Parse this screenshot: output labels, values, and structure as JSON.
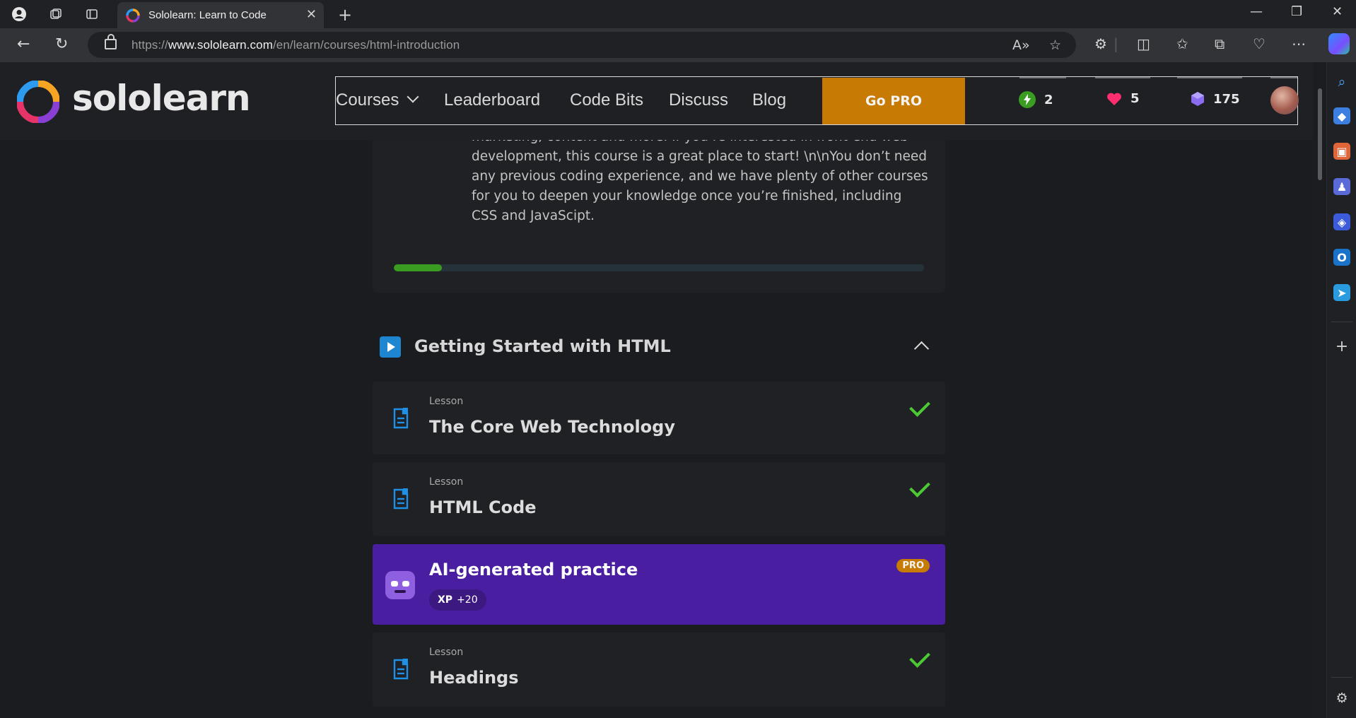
{
  "browser": {
    "tab_title": "Sololearn: Learn to Code",
    "url_prefix": "https://",
    "url_host": "www.sololearn.com",
    "url_path": "/en/learn/courses/html-introduction"
  },
  "header": {
    "logo_text": "sololearn",
    "nav": {
      "courses": "Courses",
      "leaderboard": "Leaderboard",
      "code_bits": "Code Bits",
      "discuss": "Discuss",
      "blog": "Blog"
    },
    "go_pro": "Go PRO",
    "stats": {
      "streak": "2",
      "hearts": "5",
      "gems": "175"
    }
  },
  "course": {
    "description": "marketing, content and more. If you’re interested in front-end web development, this course is a great place to start! \\n\\nYou don’t need any previous coding experience, and we have plenty of other courses for you to deepen your knowledge once you’re finished, including CSS and JavaScipt.",
    "progress": 0.09
  },
  "module": {
    "title": "Getting Started with HTML",
    "lessons": [
      {
        "type": "Lesson",
        "title": "The Core Web Technology",
        "completed": true
      },
      {
        "type": "Lesson",
        "title": "HTML Code",
        "completed": true
      },
      {
        "type": "Lesson",
        "title": "Headings",
        "completed": true
      }
    ],
    "practice": {
      "title": "AI-generated practice",
      "xp_label": "XP",
      "xp_value": "+20",
      "badge": "PRO"
    }
  },
  "colors": {
    "accent_pro": "#c87b04",
    "practice_bg": "#4a1ea0",
    "check_green": "#4cc934",
    "progress_green": "#3a9d22"
  }
}
